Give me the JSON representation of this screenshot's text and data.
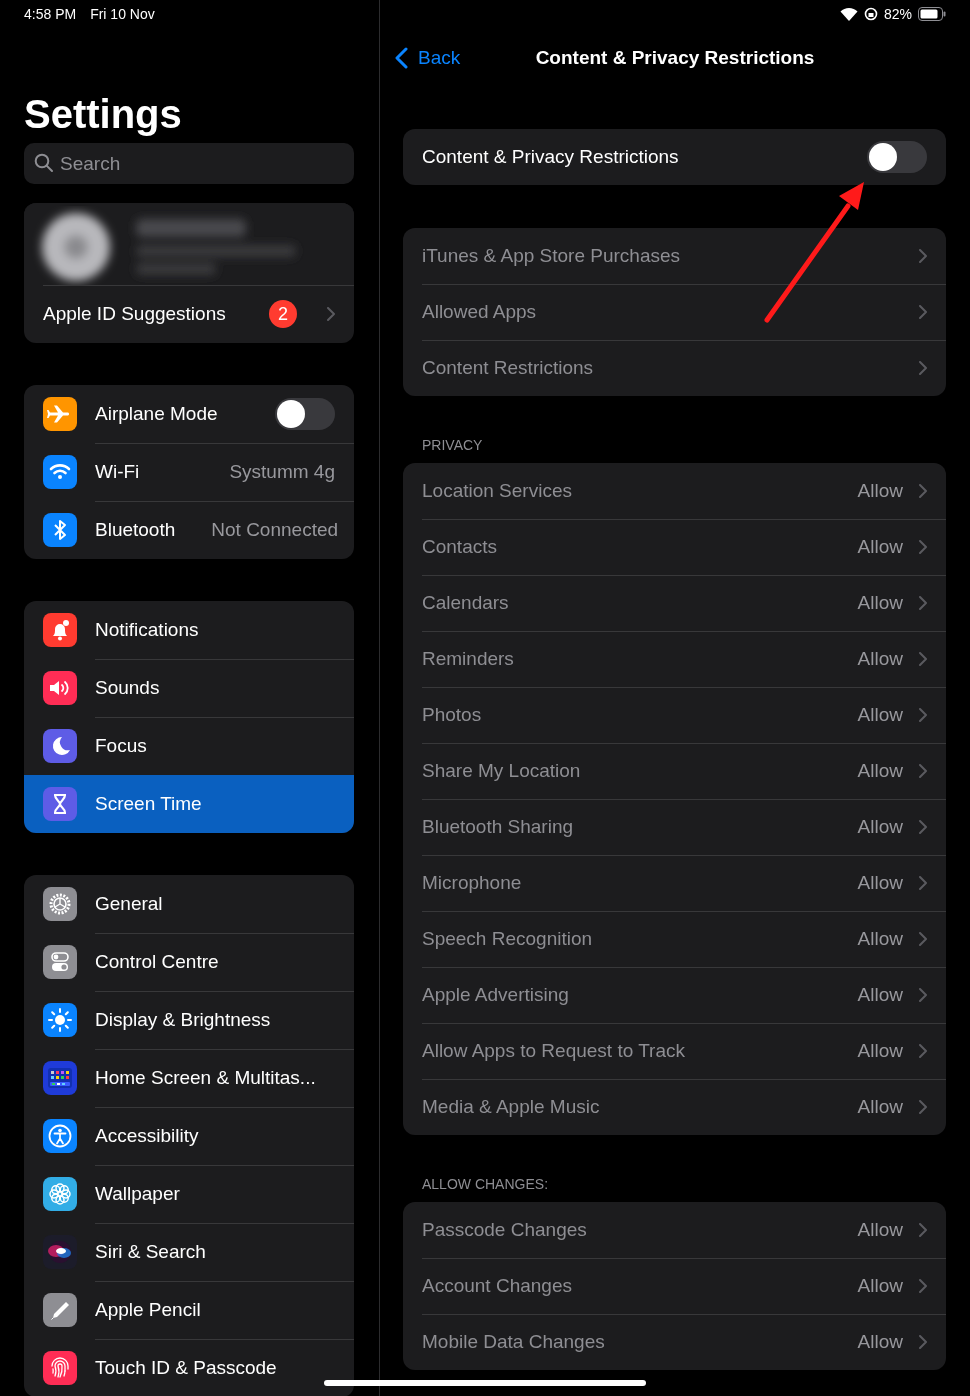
{
  "status_bar": {
    "time": "4:58 PM",
    "date": "Fri 10 Nov",
    "battery": "82%"
  },
  "sidebar": {
    "title": "Settings",
    "search": {
      "placeholder": "Search"
    },
    "profile": {
      "kind": "picture",
      "suggestions": {
        "label": "Apple ID Suggestions",
        "badge": "2"
      }
    },
    "groups": [
      {
        "items": [
          {
            "label": "Airplane Mode",
            "kind": "toggle",
            "on": false,
            "selected": false
          },
          {
            "label": "Wi-Fi",
            "kind": "value",
            "value": "Systumm 4g",
            "selected": false
          },
          {
            "label": "Bluetooth",
            "kind": "value",
            "value": "Not Connected",
            "selected": false
          }
        ]
      },
      {
        "items": [
          {
            "label": "Notifications",
            "kind": "link",
            "selected": false
          },
          {
            "label": "Sounds",
            "kind": "link",
            "selected": false
          },
          {
            "label": "Focus",
            "kind": "link",
            "selected": false
          },
          {
            "label": "Screen Time",
            "kind": "link",
            "selected": true
          }
        ]
      },
      {
        "items": [
          {
            "label": "General",
            "kind": "link",
            "selected": false
          },
          {
            "label": "Control Centre",
            "kind": "link",
            "selected": false
          },
          {
            "label": "Display & Brightness",
            "kind": "link",
            "selected": false
          },
          {
            "label": "Home Screen & Multitas...",
            "kind": "link",
            "selected": false
          },
          {
            "label": "Accessibility",
            "kind": "link",
            "selected": false
          },
          {
            "label": "Wallpaper",
            "kind": "link",
            "selected": false
          },
          {
            "label": "Siri & Search",
            "kind": "link",
            "selected": false
          },
          {
            "label": "Apple Pencil",
            "kind": "link",
            "selected": false
          },
          {
            "label": "Touch ID & Passcode",
            "kind": "link",
            "selected": false
          }
        ]
      }
    ]
  },
  "detail": {
    "back": "Back",
    "title": "Content & Privacy Restrictions",
    "master": {
      "label": "Content & Privacy Restrictions",
      "on": false
    },
    "sections": [
      {
        "items": [
          {
            "label": "iTunes & App Store Purchases",
            "disabled": true
          },
          {
            "label": "Allowed Apps",
            "disabled": true
          },
          {
            "label": "Content Restrictions",
            "disabled": true
          }
        ]
      },
      {
        "header": "PRIVACY",
        "items": [
          {
            "label": "Location Services",
            "value": "Allow",
            "disabled": true
          },
          {
            "label": "Contacts",
            "value": "Allow",
            "disabled": true
          },
          {
            "label": "Calendars",
            "value": "Allow",
            "disabled": true
          },
          {
            "label": "Reminders",
            "value": "Allow",
            "disabled": true
          },
          {
            "label": "Photos",
            "value": "Allow",
            "disabled": true
          },
          {
            "label": "Share My Location",
            "value": "Allow",
            "disabled": true
          },
          {
            "label": "Bluetooth Sharing",
            "value": "Allow",
            "disabled": true
          },
          {
            "label": "Microphone",
            "value": "Allow",
            "disabled": true
          },
          {
            "label": "Speech Recognition",
            "value": "Allow",
            "disabled": true
          },
          {
            "label": "Apple Advertising",
            "value": "Allow",
            "disabled": true
          },
          {
            "label": "Allow Apps to Request to Track",
            "value": "Allow",
            "disabled": true
          },
          {
            "label": "Media & Apple Music",
            "value": "Allow",
            "disabled": true
          }
        ]
      },
      {
        "header": "ALLOW CHANGES:",
        "items": [
          {
            "label": "Passcode Changes",
            "value": "Allow",
            "disabled": true
          },
          {
            "label": "Account Changes",
            "value": "Allow",
            "disabled": true
          },
          {
            "label": "Mobile Data Changes",
            "value": "Allow",
            "disabled": true
          }
        ]
      }
    ]
  }
}
